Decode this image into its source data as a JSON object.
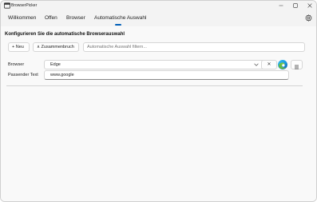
{
  "window": {
    "title": "BrowserPicker",
    "accent": "#005fb8"
  },
  "tabs": [
    {
      "label": "Willkommen"
    },
    {
      "label": "Offen"
    },
    {
      "label": "Browser"
    },
    {
      "label": "Automatische Auswahl",
      "selected": true
    }
  ],
  "main": {
    "heading": "Konfigurieren Sie die automatische Browserauswahl",
    "new_button": "+ Neu",
    "collapse_button": "∧ Zusammenbruch",
    "filter_placeholder": "Automatische Auswahl filtern..."
  },
  "rule": {
    "browser_label": "Browser",
    "browser_value": "Edge",
    "clear_symbol": "✕",
    "match_label": "Passender Text",
    "match_value": "www.google"
  },
  "icons": {
    "app": "browserpicker-icon",
    "settings": "gear-icon",
    "browser": "edge-icon",
    "menu": "hamburger-icon",
    "dropdown": "chevron-down-icon"
  }
}
